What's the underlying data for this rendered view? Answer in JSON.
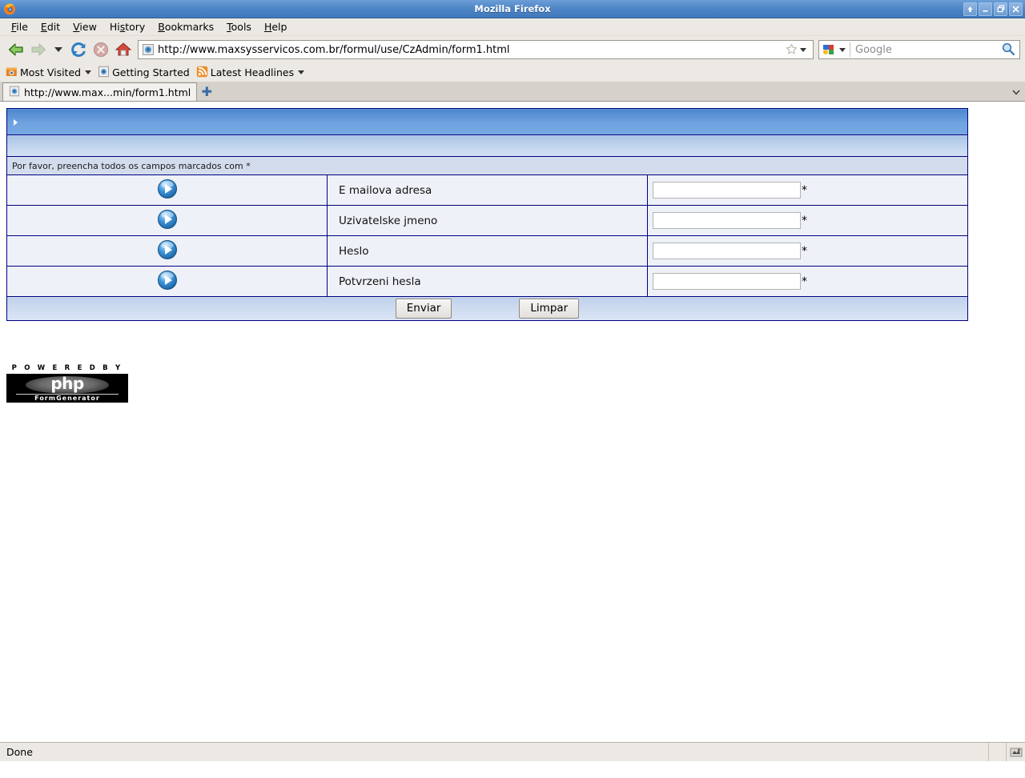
{
  "window": {
    "title": "Mozilla Firefox",
    "app_icon": "firefox-icon",
    "controls": [
      {
        "name": "shade-button",
        "glyph": "⬆"
      },
      {
        "name": "minimize-button",
        "glyph": "–"
      },
      {
        "name": "maximize-button",
        "glyph": "❐"
      },
      {
        "name": "close-button",
        "glyph": "✕"
      }
    ]
  },
  "menubar": {
    "items": [
      {
        "label": "File",
        "accel": "F"
      },
      {
        "label": "Edit",
        "accel": "E"
      },
      {
        "label": "View",
        "accel": "V"
      },
      {
        "label": "History",
        "accel": "s"
      },
      {
        "label": "Bookmarks",
        "accel": "B"
      },
      {
        "label": "Tools",
        "accel": "T"
      },
      {
        "label": "Help",
        "accel": "H"
      }
    ]
  },
  "navbar": {
    "back_icon": "back-arrow-icon",
    "forward_icon": "forward-arrow-icon",
    "history_dropdown_icon": "chevron-down-icon",
    "reload_icon": "reload-icon",
    "stop_icon": "stop-icon",
    "home_icon": "home-icon",
    "url": "http://www.maxsysservicos.com.br/formul/use/CzAdmin/form1.html",
    "url_favicon": "page-icon",
    "bookmark_star_icon": "star-icon",
    "go_dropdown_icon": "chevron-down-icon"
  },
  "search": {
    "engine_icon": "google-icon",
    "engine_dropdown_icon": "chevron-down-icon",
    "placeholder": "Google",
    "submit_icon": "magnifier-icon"
  },
  "bookmarks_bar": {
    "items": [
      {
        "label": "Most Visited",
        "icon": "most-visited-icon",
        "has_caret": true
      },
      {
        "label": "Getting Started",
        "icon": "page-icon",
        "has_caret": false
      },
      {
        "label": "Latest Headlines",
        "icon": "rss-icon",
        "has_caret": true
      }
    ]
  },
  "tabbar": {
    "tabs": [
      {
        "label": "http://www.max...min/form1.html",
        "icon": "page-icon",
        "active": true
      }
    ],
    "new_tab_glyph": "✚",
    "tab_list_icon": "chevron-down-icon"
  },
  "form": {
    "header_marker_icon": "triangle-right-icon",
    "instruction": "Por favor, preencha todos os campos marcados com *",
    "required_marker": "*",
    "row_icon": "blue-arrow-bullet-icon",
    "fields": [
      {
        "label": "E mailova adresa",
        "value": "",
        "required": true
      },
      {
        "label": "Uzivatelske jmeno",
        "value": "",
        "required": true
      },
      {
        "label": "Heslo",
        "value": "",
        "required": true
      },
      {
        "label": "Potvrzeni hesla",
        "value": "",
        "required": true
      }
    ],
    "submit_label": "Enviar",
    "reset_label": "Limpar"
  },
  "footer_logo": {
    "powered_by": "P O W E R E D   B Y",
    "php": "php",
    "product": "FormGenerator"
  },
  "statusbar": {
    "text": "Done",
    "indicator_icon": "connection-icon"
  },
  "colors": {
    "titlebar": "#4f86c6",
    "form_header": "#6fa3e0",
    "table_border": "#000080",
    "cell_bg": "#eef1f7",
    "chrome": "#ece9e4"
  }
}
